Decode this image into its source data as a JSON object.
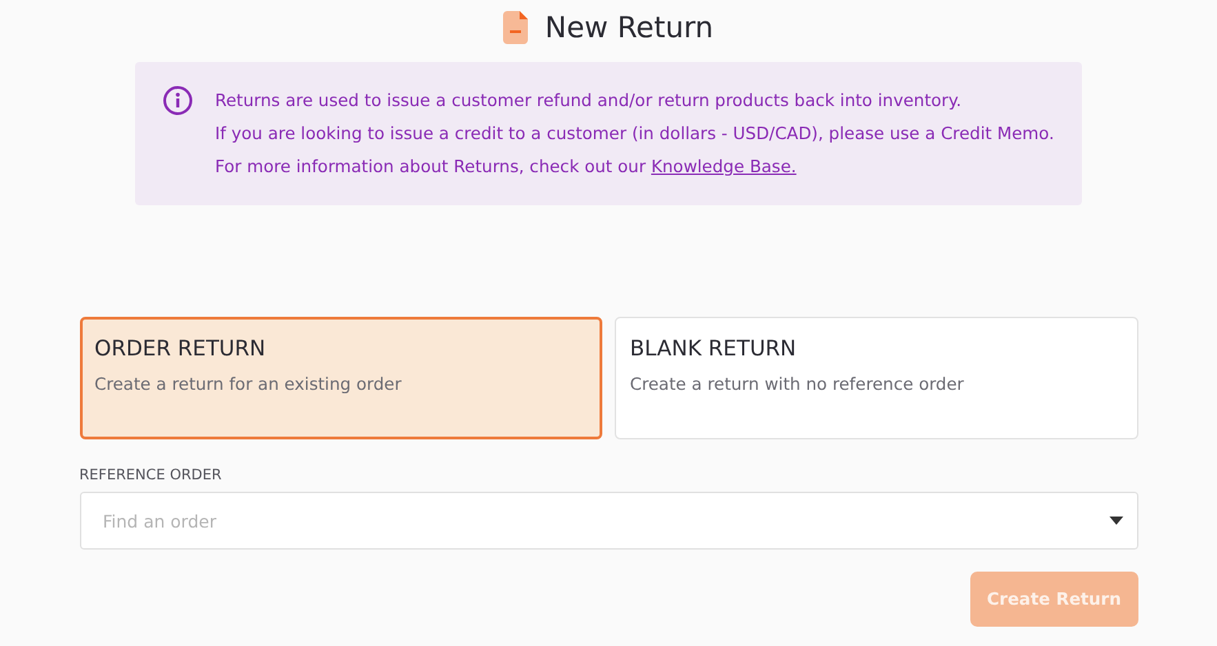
{
  "header": {
    "title": "New Return"
  },
  "info": {
    "lines": [
      {
        "text": "Returns are used to issue a customer refund and/or return products back into inventory."
      },
      {
        "text": "If you are looking to issue a credit to a customer (in dollars - USD/CAD), please use a Credit Memo."
      },
      {
        "text": "For more information about Returns, check out our ",
        "link": "Knowledge Base."
      }
    ]
  },
  "return_types": [
    {
      "title": "ORDER RETURN",
      "description": "Create a return for an existing order",
      "selected": true
    },
    {
      "title": "BLANK RETURN",
      "description": "Create a return with no reference order",
      "selected": false
    }
  ],
  "reference_order": {
    "label": "REFERENCE ORDER",
    "placeholder": "Find an order"
  },
  "submit": {
    "label": "Create Return",
    "disabled": true
  }
}
